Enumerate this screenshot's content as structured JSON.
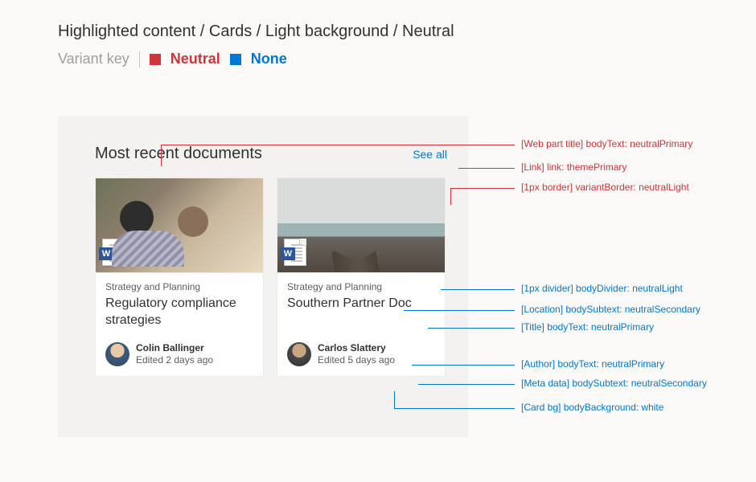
{
  "page": {
    "breadcrumb": "Highlighted content / Cards / Light background / Neutral",
    "variant_key_label": "Variant key",
    "variant_neutral": "Neutral",
    "variant_none": "None"
  },
  "panel": {
    "title": "Most recent documents",
    "see_all": "See all"
  },
  "cards": [
    {
      "location": "Strategy and Planning",
      "title": "Regulatory compliance strategies",
      "file_type": "W",
      "author": "Colin Ballinger",
      "meta": "Edited 2 days ago"
    },
    {
      "location": "Strategy and Planning",
      "title": "Southern Partner Doc",
      "file_type": "W",
      "author": "Carlos Slattery",
      "meta": "Edited 5 days ago"
    }
  ],
  "annotations": {
    "a1": "[Web part title] bodyText: neutralPrimary",
    "a2": "[Link] link: themePrimary",
    "a3": "[1px border] variantBorder: neutralLight",
    "a4": "[1px divider] bodyDivider: neutralLight",
    "a5": "[Location] bodySubtext: neutralSecondary",
    "a6": "[Title] bodyText: neutralPrimary",
    "a7": "[Author] bodyText: neutralPrimary",
    "a8": "[Meta data] bodySubtext: neutralSecondary",
    "a9": "[Card bg] bodyBackground: white"
  },
  "colors": {
    "neutralPrimary": "#323130",
    "neutralSecondary": "#605e5c",
    "neutralLight": "#edebe9",
    "themePrimary": "#0078d4",
    "white": "#ffffff",
    "neutralBg": "#f3f2f1",
    "redAccent": "#d13438"
  }
}
